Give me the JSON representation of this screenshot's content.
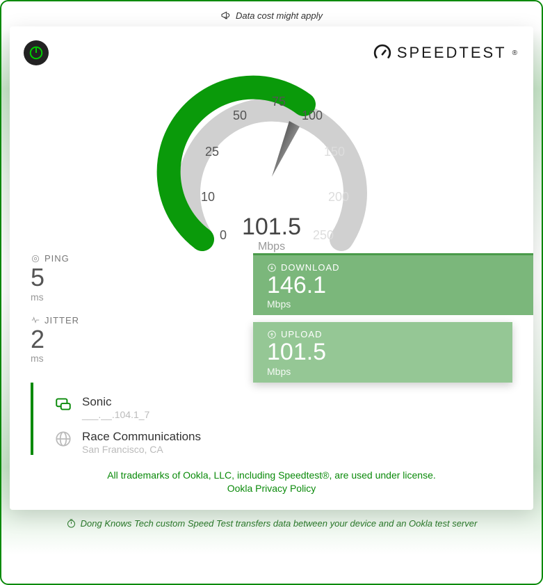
{
  "topNote": "Data cost might apply",
  "brand": "SPEEDTEST",
  "gauge": {
    "value": "101.5",
    "unit": "Mbps",
    "ticks": [
      "0",
      "10",
      "25",
      "50",
      "75",
      "100",
      "150",
      "200",
      "250"
    ]
  },
  "ping": {
    "label": "PING",
    "value": "5",
    "unit": "ms"
  },
  "jitter": {
    "label": "JITTER",
    "value": "2",
    "unit": "ms"
  },
  "download": {
    "label": "DOWNLOAD",
    "value": "146.1",
    "unit": "Mbps"
  },
  "upload": {
    "label": "UPLOAD",
    "value": "101.5",
    "unit": "Mbps"
  },
  "isp": {
    "name": "Sonic",
    "ip": "___.__.104.1_7"
  },
  "server": {
    "name": "Race Communications",
    "location": "San Francisco, CA"
  },
  "footer1": "All trademarks of Ookla, LLC, including Speedtest®, are used under license.",
  "footer2": "Ookla Privacy Policy",
  "bottomNote": "Dong Knows Tech custom Speed Test transfers data between your device and an Ookla test server"
}
